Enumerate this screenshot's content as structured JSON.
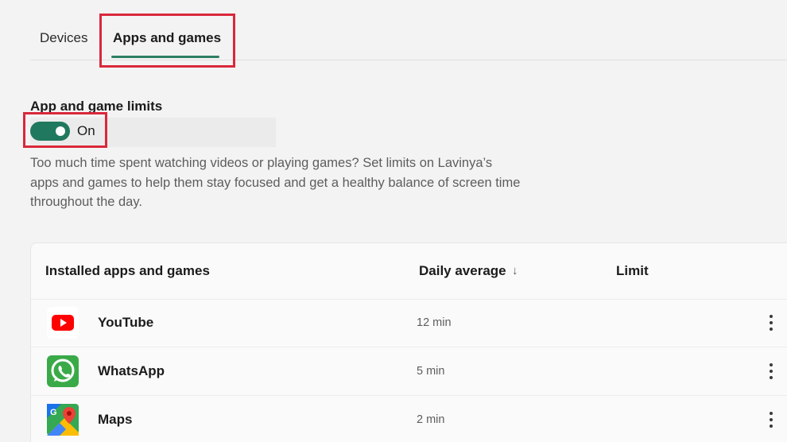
{
  "tabs": {
    "devices": "Devices",
    "apps": "Apps and games"
  },
  "limits": {
    "title": "App and game limits",
    "toggle_state": "On",
    "description": "Too much time spent watching videos or playing games? Set limits on Lavinya’s apps and games to help them stay focused and get a healthy balance of screen time throughout the day."
  },
  "table": {
    "col_apps": "Installed apps and games",
    "col_daily": "Daily average",
    "sort_glyph": "↓",
    "col_limit": "Limit",
    "rows": [
      {
        "name": "YouTube",
        "time": "12 min",
        "icon": "youtube-icon"
      },
      {
        "name": "WhatsApp",
        "time": "5 min",
        "icon": "whatsapp-icon"
      },
      {
        "name": "Maps",
        "time": "2 min",
        "icon": "maps-icon"
      }
    ]
  },
  "colors": {
    "accent": "#20785e",
    "highlight": "#d9283b"
  }
}
